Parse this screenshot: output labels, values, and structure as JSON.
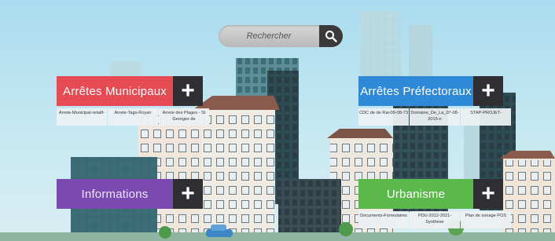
{
  "search": {
    "placeholder": "Rechercher",
    "icon": "magnifier"
  },
  "categories": {
    "municipaux": {
      "label": "Arrêtes Municipaux",
      "color": "#e64a52",
      "subitems": [
        "Arrete-Municipal-relatif-",
        "Arrete-Tags-Royan",
        "Arrete des Plages - St Georges de"
      ]
    },
    "prefectoraux": {
      "label": "Arrêtes Préfectoraux",
      "color": "#2e8ad8",
      "subitems": [
        "CDC de de Rai-09-08-73",
        "Domaine_De_La_07-08-2015-n",
        "STAP-PROJET-"
      ]
    },
    "informations": {
      "label": "Informations",
      "color": "#7a4ab0",
      "subitems": []
    },
    "urbanisme": {
      "label": "Urbanisme",
      "color": "#5bb84a",
      "subitems": [
        "Documents-Formulaires",
        "PDU-2012-2021-Synthese",
        "Plan de zonage POS"
      ]
    }
  },
  "plus_label": "+"
}
